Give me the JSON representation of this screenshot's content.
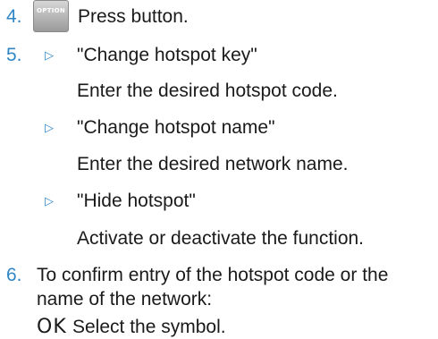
{
  "steps": {
    "s4": {
      "number": "4.",
      "button_label": "OPTION",
      "text": "Press button."
    },
    "s5": {
      "number": "5.",
      "bullet_icon": "triangle-right-outline",
      "items": [
        {
          "label": "\"Change hotspot key\"",
          "desc": "Enter the desired hotspot code."
        },
        {
          "label": "\"Change hotspot name\"",
          "desc": "Enter the desired network name."
        },
        {
          "label": "\"Hide hotspot\"",
          "desc": "Activate or deactivate the function."
        }
      ]
    },
    "s6": {
      "number": "6.",
      "line1": "To confirm entry of the hotspot code or the",
      "line2": "name of the network:",
      "symbol": "OK",
      "symbol_text": "Select the symbol."
    }
  },
  "colors": {
    "accent": "#2f86c6",
    "text": "#1a1a1a"
  }
}
